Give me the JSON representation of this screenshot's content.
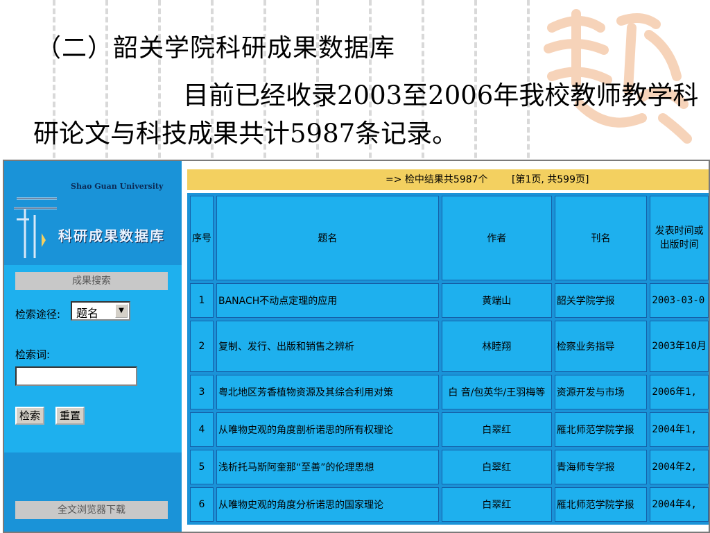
{
  "slide": {
    "title": "（二）韶关学院科研成果数据库",
    "body": "目前已经收录2003至2006年我校教师教学科研论文与科技成果共计5987条记录。"
  },
  "app": {
    "logo_english": "Shao Guan University",
    "logo_chinese": "科研成果数据库"
  },
  "search": {
    "header": "成果搜索",
    "path_label": "检索途径:",
    "path_value": "题名",
    "keyword_label": "检索词:",
    "keyword_value": "",
    "search_button": "检索",
    "reset_button": "重置"
  },
  "download": {
    "header": "全文浏览器下载"
  },
  "results": {
    "summary": "=> 检中结果共5987个",
    "page_info": "[第1页, 共599页]",
    "columns": [
      "序号",
      "题名",
      "作者",
      "刊名",
      "发表时间或出版时间"
    ],
    "rows": [
      {
        "no": "1",
        "title": "BANACH不动点定理的应用",
        "author": "黄端山",
        "journal": "韶关学院学报",
        "date": "2003-03-0"
      },
      {
        "no": "2",
        "title": "复制、发行、出版和销售之辨析",
        "author": "林睦翔",
        "journal": "检察业务指导",
        "date": "2003年10月"
      },
      {
        "no": "3",
        "title": "粤北地区芳香植物资源及其综合利用对策",
        "author": "白 音/包英华/王羽梅等",
        "journal": "资源开发与市场",
        "date": "2006年1,"
      },
      {
        "no": "4",
        "title": "从唯物史观的角度剖析诺思的所有权理论",
        "author": "白翠红",
        "journal": "雁北师范学院学报",
        "date": "2004年1,"
      },
      {
        "no": "5",
        "title": "浅析托马斯阿奎那“至善”的伦理思想",
        "author": "白翠红",
        "journal": "青海师专学报",
        "date": "2004年2,"
      },
      {
        "no": "6",
        "title": "从唯物史观的角度分析诺思的国家理论",
        "author": "白翠红",
        "journal": "雁北师范学院学报",
        "date": "2004年4,"
      }
    ]
  },
  "colors": {
    "sidebar": "#1a93d8",
    "panel": "#1eb0ee",
    "banner": "#f3d060",
    "watermark": "#f0b080"
  }
}
